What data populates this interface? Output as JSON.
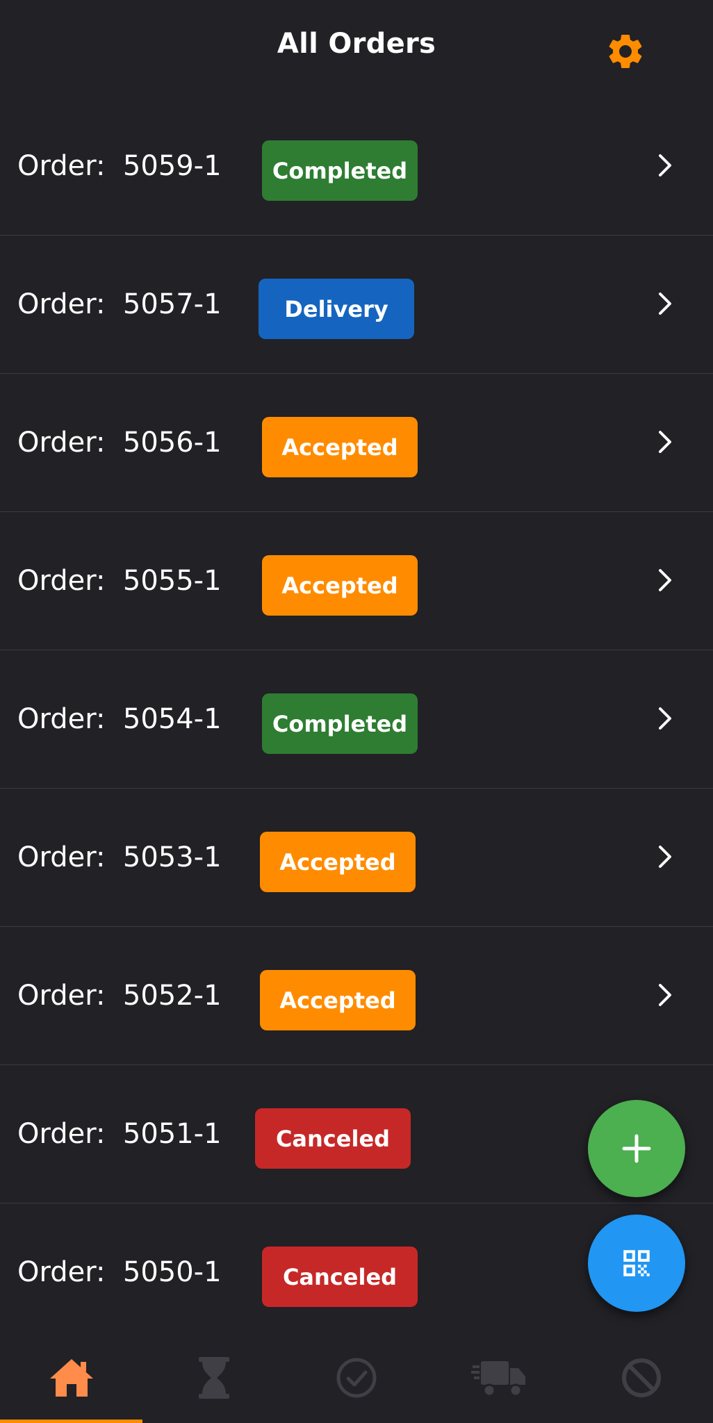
{
  "header": {
    "title": "All Orders",
    "settings_icon": "gear-icon"
  },
  "colors": {
    "background": "#212126",
    "completed": "#2e7d32",
    "delivery": "#1565c0",
    "accepted": "#ff8c00",
    "canceled": "#c62828",
    "fab_add": "#4caf50",
    "fab_qr": "#2196f3",
    "nav_active": "#ff8c4a",
    "nav_inactive": "#3f3f45"
  },
  "orders": [
    {
      "label": "Order:  5059-1",
      "status": "Completed"
    },
    {
      "label": "Order:  5057-1",
      "status": "Delivery"
    },
    {
      "label": "Order:  5056-1",
      "status": "Accepted"
    },
    {
      "label": "Order:  5055-1",
      "status": "Accepted"
    },
    {
      "label": "Order:  5054-1",
      "status": "Completed"
    },
    {
      "label": "Order:  5053-1",
      "status": "Accepted"
    },
    {
      "label": "Order:  5052-1",
      "status": "Accepted"
    },
    {
      "label": "Order:  5051-1",
      "status": "Canceled"
    },
    {
      "label": "Order:  5050-1",
      "status": "Canceled"
    }
  ],
  "fabs": {
    "add_icon": "plus-icon",
    "qr_icon": "qr-code-icon"
  },
  "bottom_nav": {
    "items": [
      {
        "icon": "home-icon",
        "active": true
      },
      {
        "icon": "hourglass-icon",
        "active": false
      },
      {
        "icon": "check-circle-icon",
        "active": false
      },
      {
        "icon": "delivery-truck-icon",
        "active": false
      },
      {
        "icon": "block-icon",
        "active": false
      }
    ]
  }
}
